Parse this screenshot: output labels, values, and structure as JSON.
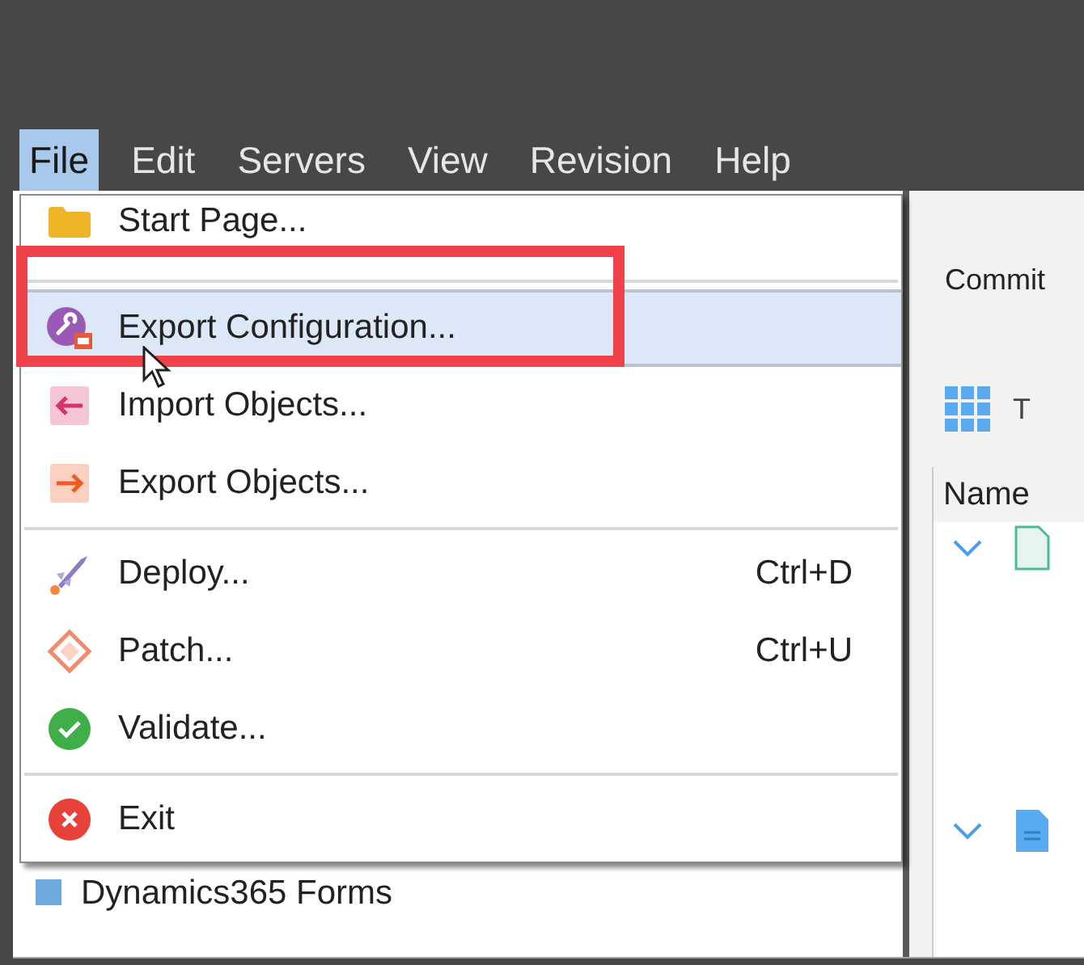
{
  "menu_bar": [
    {
      "label": "File",
      "selected": true
    },
    {
      "label": "Edit",
      "selected": false
    },
    {
      "label": "Servers",
      "selected": false
    },
    {
      "label": "View",
      "selected": false
    },
    {
      "label": "Revision",
      "selected": false
    },
    {
      "label": "Help",
      "selected": false
    }
  ],
  "file_menu": [
    {
      "kind": "item",
      "label": "Start Page...",
      "selected": false
    },
    {
      "kind": "separator"
    },
    {
      "kind": "item",
      "label": "Export Configuration...",
      "selected": true
    },
    {
      "kind": "item",
      "label": "Import Objects...",
      "selected": false
    },
    {
      "kind": "item",
      "label": "Export Objects...",
      "selected": false
    },
    {
      "kind": "separator"
    },
    {
      "kind": "item",
      "label": "Deploy...",
      "shortcut": "Ctrl+D",
      "selected": false
    },
    {
      "kind": "item",
      "label": "Patch...",
      "shortcut": "Ctrl+U",
      "selected": false
    },
    {
      "kind": "item",
      "label": "Validate...",
      "selected": false
    },
    {
      "kind": "separator"
    },
    {
      "kind": "item",
      "label": "Exit",
      "selected": false
    }
  ],
  "left_panel": {
    "items": [
      {
        "label": "Dynamics365 Forms"
      }
    ]
  },
  "right_panel": {
    "tab": "Commit",
    "toolbar_label": "T",
    "column": "Name",
    "tree_rows": [
      {
        "expanded": true
      },
      {
        "expanded": true
      }
    ]
  }
}
